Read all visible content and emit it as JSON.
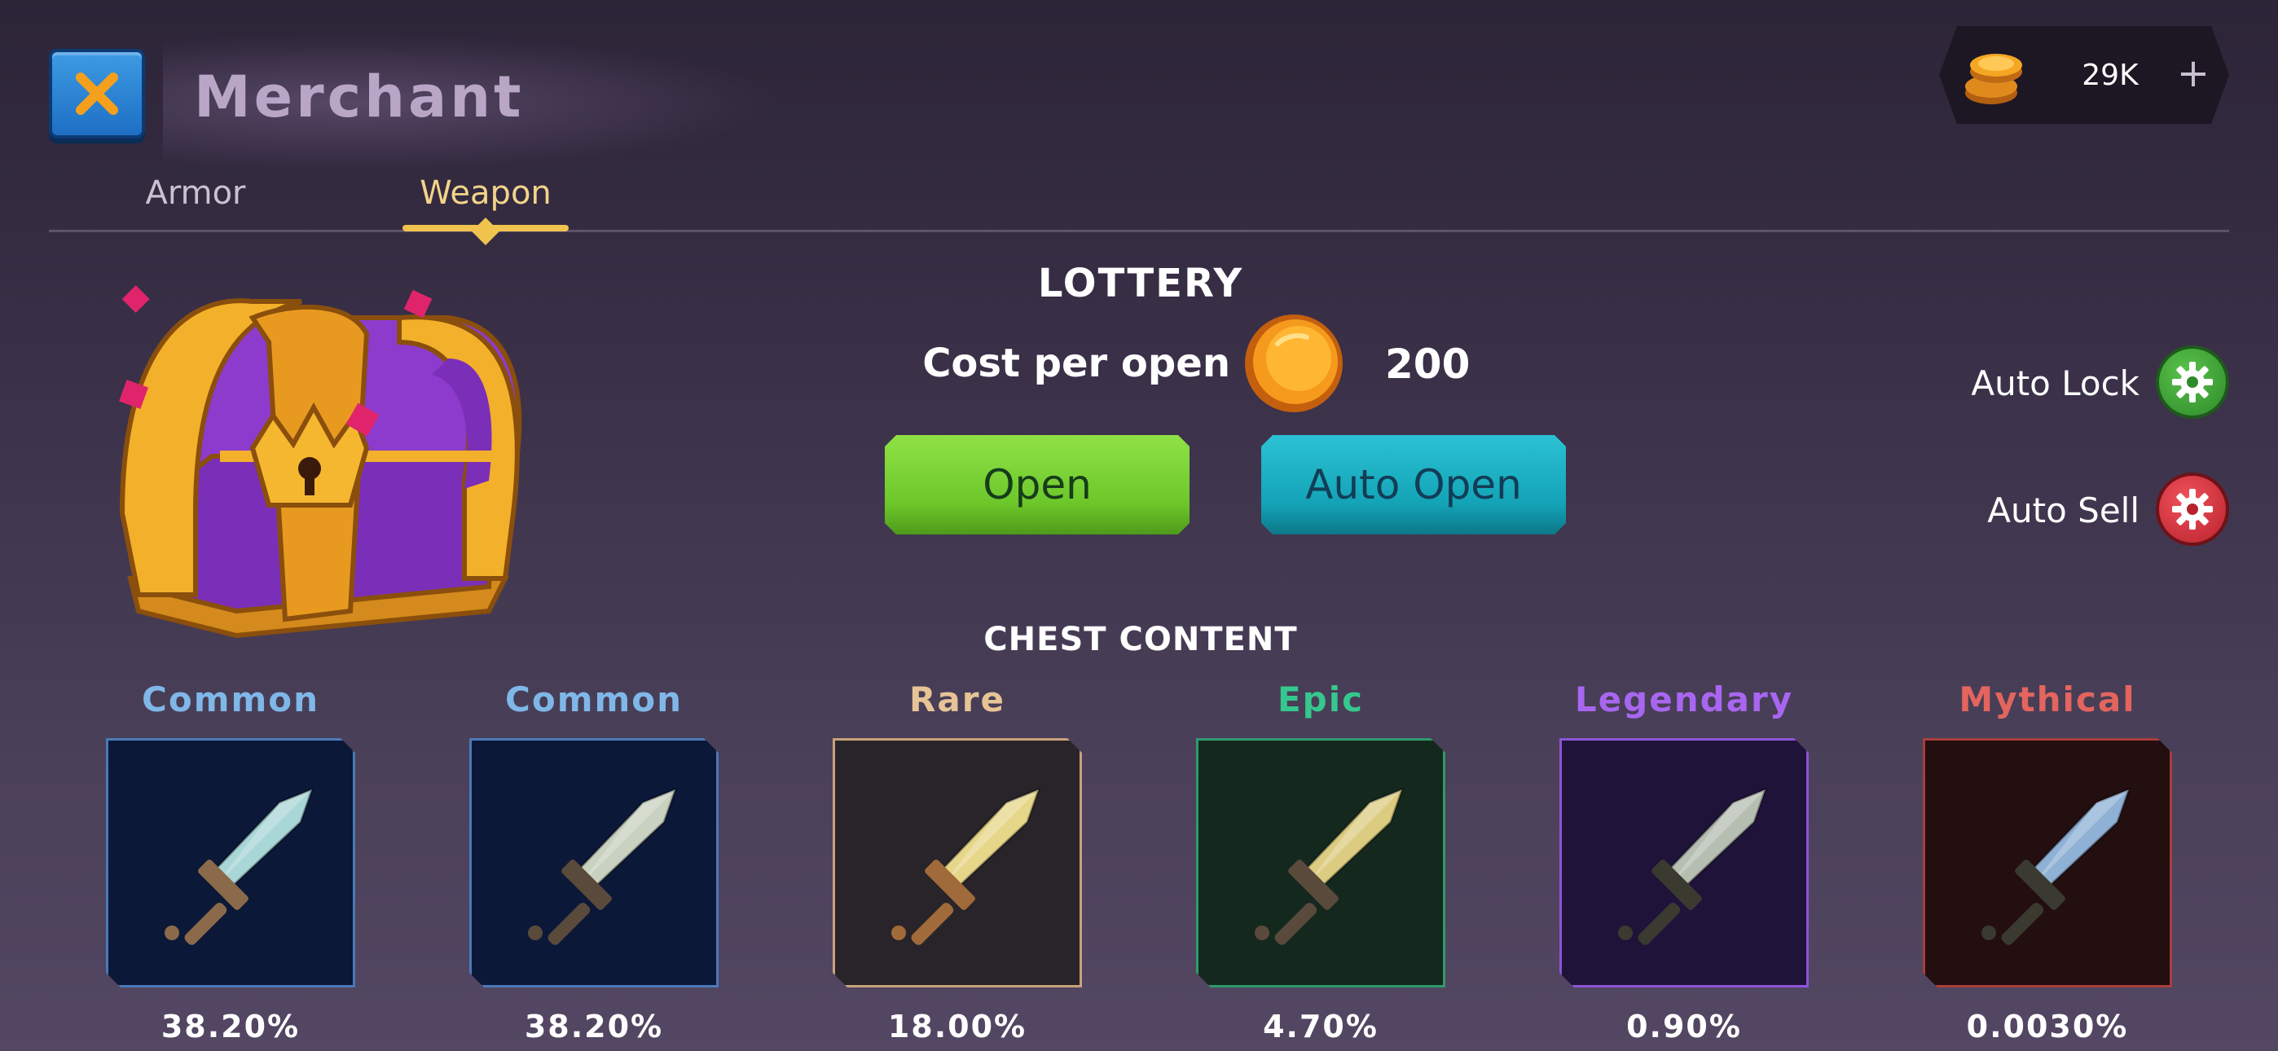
{
  "header": {
    "title": "Merchant",
    "currency_amount": "29K",
    "plus_label": "+"
  },
  "tabs": [
    {
      "label": "Armor",
      "active": false
    },
    {
      "label": "Weapon",
      "active": true
    }
  ],
  "lottery": {
    "title": "LOTTERY",
    "cost_label": "Cost per open",
    "cost_value": "200",
    "open_label": "Open",
    "auto_open_label": "Auto Open"
  },
  "toggles": {
    "auto_lock_label": "Auto Lock",
    "auto_sell_label": "Auto Sell"
  },
  "content": {
    "title": "CHEST CONTENT",
    "tiers": [
      {
        "name": "Common",
        "percent": "38.20%",
        "name_color": "#7fb7e8",
        "box_bg": "#0c1838",
        "border": "#4b79b8",
        "blade": "#a9d6d6",
        "hilt": "#8a6a4a"
      },
      {
        "name": "Common",
        "percent": "38.20%",
        "name_color": "#7fb7e8",
        "box_bg": "#0c1838",
        "border": "#4b79b8",
        "blade": "#c9d2c0",
        "hilt": "#5a4a3c"
      },
      {
        "name": "Rare",
        "percent": "18.00%",
        "name_color": "#e7c496",
        "box_bg": "#28242a",
        "border": "#c9a27a",
        "blade": "#e6d68a",
        "hilt": "#a06a3a"
      },
      {
        "name": "Epic",
        "percent": "4.70%",
        "name_color": "#35c88e",
        "box_bg": "#14281e",
        "border": "#2e9a6e",
        "blade": "#dccc82",
        "hilt": "#5a4a3c"
      },
      {
        "name": "Legendary",
        "percent": "0.90%",
        "name_color": "#a866f0",
        "box_bg": "#20133a",
        "border": "#8d54d6",
        "blade": "#b6beb2",
        "hilt": "#3a3a30"
      },
      {
        "name": "Mythical",
        "percent": "0.0030%",
        "name_color": "#e3655e",
        "box_bg": "#230e10",
        "border": "#a83e3a",
        "blade": "#8fb1d6",
        "hilt": "#3a3a30"
      }
    ]
  },
  "colors": {
    "accent_gold": "#f0c24e",
    "open_green": "#6cc62a",
    "auto_open_teal": "#13a2b6"
  },
  "icons": {
    "close": "close-icon",
    "coin": "coin-icon",
    "gear": "gear-icon",
    "chest": "treasure-chest-icon",
    "sword": "sword-icon"
  }
}
